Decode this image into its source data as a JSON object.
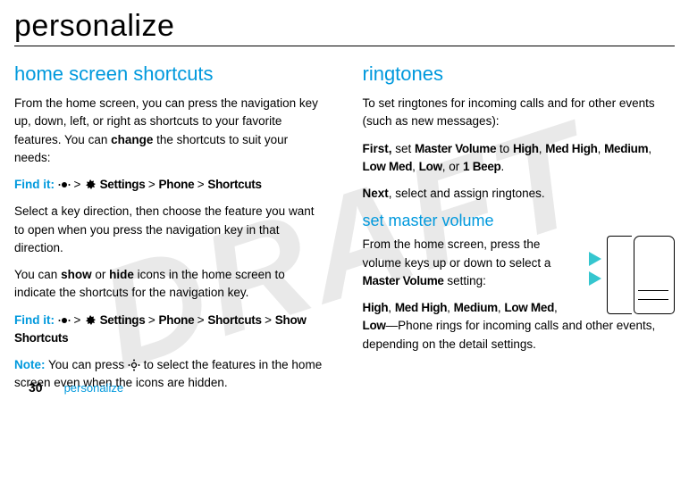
{
  "watermark": "DRAFT",
  "page_title": "personalize",
  "left": {
    "h2": "home screen shortcuts",
    "p1_a": "From the home screen, you can press the navigation key up, down, left, or right as shortcuts to your favorite features. You can ",
    "p1_bold": "change",
    "p1_b": " the shortcuts to suit your needs:",
    "findit1_label": "Find it:",
    "findit1_sep1": " > ",
    "findit1_settings": " Settings ",
    "findit1_sep2": "> ",
    "findit1_phone": "Phone ",
    "findit1_sep3": "> ",
    "findit1_shortcuts": "Shortcuts",
    "p2": "Select a key direction, then choose the feature you want to open when you press the navigation key in that direction.",
    "p3_a": "You can ",
    "p3_bold1": "show",
    "p3_mid": " or ",
    "p3_bold2": "hide",
    "p3_b": " icons in the home screen to indicate the shortcuts for the navigation key.",
    "findit2_label": "Find it:",
    "findit2_sep1": " > ",
    "findit2_settings": " Settings ",
    "findit2_sep2": "> ",
    "findit2_phone": "Phone ",
    "findit2_sep3": "> ",
    "findit2_shortcuts": "Shortcuts ",
    "findit2_sep4": "> ",
    "findit2_show": "Show Shortcuts",
    "note_label": "Note:",
    "note_a": " You can press ",
    "note_b": " to select the features in the home screen even when the icons are hidden."
  },
  "right": {
    "h2": "ringtones",
    "p1": "To set ringtones for incoming calls and for other events (such as new messages):",
    "first_label": "First,",
    "first_a": " set ",
    "first_mv": "Master Volume",
    "first_to": " to ",
    "opt_high": "High",
    "comma": ", ",
    "opt_medhigh": "Med High",
    "opt_medium": "Medium",
    "opt_lowmed": "Low Med",
    "opt_low": "Low",
    "or": ", or ",
    "opt_1beep": "1 Beep",
    "period": ".",
    "next_label": "Next",
    "next_text": ", select and assign ringtones.",
    "h3": "set master volume",
    "p3_a": "From the home screen, press the volume keys up or down to select a ",
    "p3_mv": "Master Volume",
    "p3_b": " setting:",
    "line_high": "High",
    "line_medhigh": "Med High",
    "line_medium": "Medium",
    "line_lowmed": "Low Med",
    "line_low": "Low",
    "line_low_desc": "—Phone rings for incoming calls and other events, depending on the detail settings."
  },
  "footer": {
    "page": "30",
    "section": "personalize"
  }
}
